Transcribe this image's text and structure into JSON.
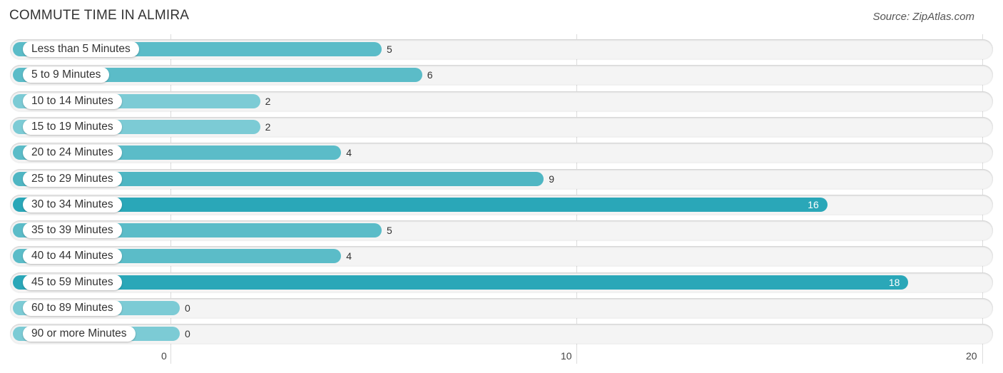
{
  "header": {
    "title": "COMMUTE TIME IN ALMIRA",
    "source": "Source: ZipAtlas.com"
  },
  "chart_data": {
    "type": "bar",
    "orientation": "horizontal",
    "title": "COMMUTE TIME IN ALMIRA",
    "source": "Source: ZipAtlas.com",
    "categories": [
      "Less than 5 Minutes",
      "5 to 9 Minutes",
      "10 to 14 Minutes",
      "15 to 19 Minutes",
      "20 to 24 Minutes",
      "25 to 29 Minutes",
      "30 to 34 Minutes",
      "35 to 39 Minutes",
      "40 to 44 Minutes",
      "45 to 59 Minutes",
      "60 to 89 Minutes",
      "90 or more Minutes"
    ],
    "values": [
      5,
      6,
      2,
      2,
      4,
      9,
      16,
      5,
      4,
      18,
      0,
      0
    ],
    "xlabel": "",
    "ylabel": "",
    "xlim": [
      0,
      20
    ],
    "xticks": [
      "0",
      "10",
      "20"
    ],
    "grid": true,
    "colors": {
      "high": "#2aa7b8",
      "mid": "#5bbcc8",
      "low": "#7ccbd5"
    }
  }
}
